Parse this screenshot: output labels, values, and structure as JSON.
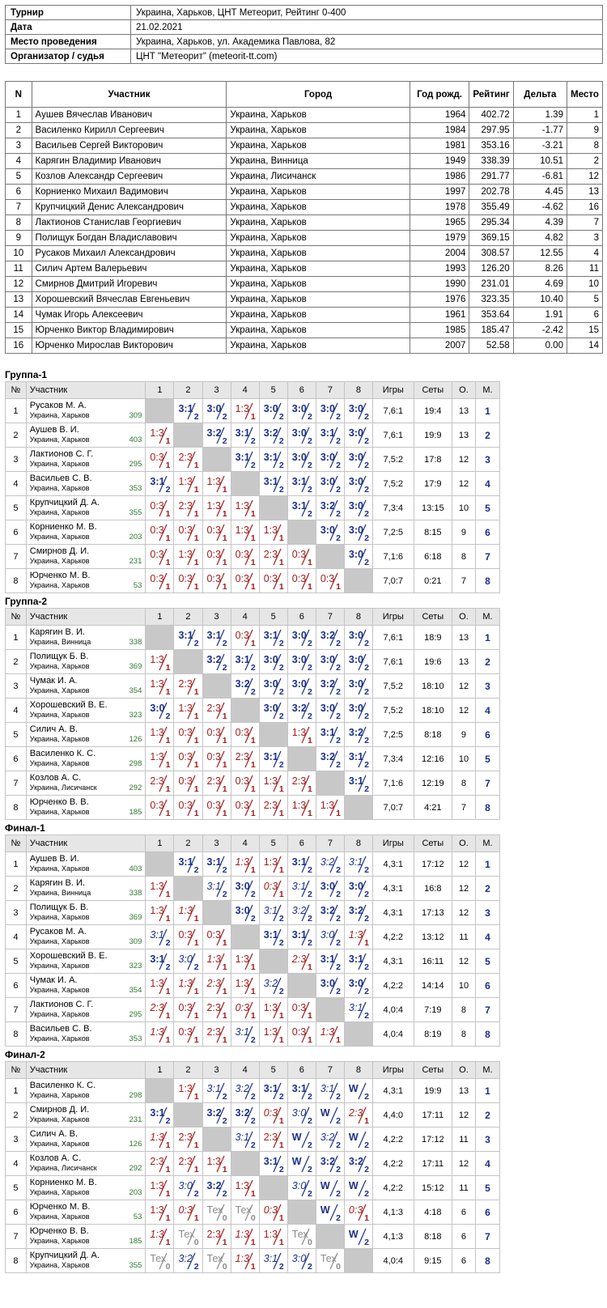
{
  "tournament": {
    "rows": [
      {
        "label": "Турнир",
        "value": "Украина, Харьков, ЦНТ Метеорит, Рейтинг 0-400"
      },
      {
        "label": "Дата",
        "value": "21.02.2021"
      },
      {
        "label": "Место проведения",
        "value": "Украина, Харьков, ул. Академика Павлова, 82"
      },
      {
        "label": "Организатор / судья",
        "value": "ЦНТ \"Метеорит\" (meteorit-tt.com)"
      }
    ]
  },
  "participants": {
    "headers": [
      "N",
      "Участник",
      "Город",
      "Год рожд.",
      "Рейтинг",
      "Дельта",
      "Место"
    ],
    "rows": [
      [
        "1",
        "Аушев Вячеслав Иванович",
        "Украина, Харьков",
        "1964",
        "402.72",
        "1.39",
        "1"
      ],
      [
        "2",
        "Василенко Кирилл Сергеевич",
        "Украина, Харьков",
        "1984",
        "297.95",
        "-1.77",
        "9"
      ],
      [
        "3",
        "Васильев Сергей Викторович",
        "Украина, Харьков",
        "1981",
        "353.16",
        "-3.21",
        "8"
      ],
      [
        "4",
        "Карягин Владимир Иванович",
        "Украина, Винница",
        "1949",
        "338.39",
        "10.51",
        "2"
      ],
      [
        "5",
        "Козлов Александр Сергеевич",
        "Украина, Лисичанск",
        "1986",
        "291.77",
        "-6.81",
        "12"
      ],
      [
        "6",
        "Корниенко Михаил Вадимович",
        "Украина, Харьков",
        "1997",
        "202.78",
        "4.45",
        "13"
      ],
      [
        "7",
        "Крупчицкий Денис Александрович",
        "Украина, Харьков",
        "1978",
        "355.49",
        "-4.62",
        "16"
      ],
      [
        "8",
        "Лактионов Станислав Георгиевич",
        "Украина, Харьков",
        "1965",
        "295.34",
        "4.39",
        "7"
      ],
      [
        "9",
        "Полищук Богдан Владиславович",
        "Украина, Харьков",
        "1979",
        "369.15",
        "4.82",
        "3"
      ],
      [
        "10",
        "Русаков Михаил Александрович",
        "Украина, Харьков",
        "2004",
        "308.57",
        "12.55",
        "4"
      ],
      [
        "11",
        "Силич Артем Валерьевич",
        "Украина, Харьков",
        "1993",
        "126.20",
        "8.26",
        "11"
      ],
      [
        "12",
        "Смирнов Дмитрий Игоревич",
        "Украина, Харьков",
        "1990",
        "231.01",
        "4.69",
        "10"
      ],
      [
        "13",
        "Хорошевский Вячеслав Евгеньевич",
        "Украина, Харьков",
        "1976",
        "323.35",
        "10.40",
        "5"
      ],
      [
        "14",
        "Чумак Игорь Алексеевич",
        "Украина, Харьков",
        "1961",
        "353.64",
        "1.91",
        "6"
      ],
      [
        "15",
        "Юрченко Виктор Владимирович",
        "Украина, Харьков",
        "1985",
        "185.47",
        "-2.42",
        "15"
      ],
      [
        "16",
        "Юрченко Мирослав Викторович",
        "Украина, Харьков",
        "2007",
        "52.58",
        "0.00",
        "14"
      ]
    ]
  },
  "grid_headers": [
    "№",
    "Участник",
    "1",
    "2",
    "3",
    "4",
    "5",
    "6",
    "7",
    "8",
    "Игры",
    "Сеты",
    "О.",
    "М."
  ],
  "groups": [
    {
      "title": "Группа-1",
      "rows": [
        {
          "n": "1",
          "name": "Русаков М. А.",
          "city": "Украина, Харьков",
          "rating": "309",
          "cells": [
            "X",
            "w3:1",
            "w3:0",
            "l1:3",
            "w3:0",
            "w3:0",
            "w3:0",
            "w3:0"
          ],
          "games": "7,6:1",
          "sets": "19:4",
          "pts": "13",
          "place": "1"
        },
        {
          "n": "2",
          "name": "Аушев В. И.",
          "city": "Украина, Харьков",
          "rating": "403",
          "cells": [
            "l1:3",
            "X",
            "w3:2",
            "w3:1",
            "w3:2",
            "w3:0",
            "w3:1",
            "w3:0"
          ],
          "games": "7,6:1",
          "sets": "19:9",
          "pts": "13",
          "place": "2"
        },
        {
          "n": "3",
          "name": "Лактионов С. Г.",
          "city": "Украина, Харьков",
          "rating": "295",
          "cells": [
            "l0:3",
            "l2:3",
            "X",
            "w3:1",
            "w3:1",
            "w3:0",
            "w3:0",
            "w3:0"
          ],
          "games": "7,5:2",
          "sets": "17:8",
          "pts": "12",
          "place": "3"
        },
        {
          "n": "4",
          "name": "Васильев С. В.",
          "city": "Украина, Харьков",
          "rating": "353",
          "cells": [
            "w3:1",
            "l1:3",
            "l1:3",
            "X",
            "w3:1",
            "w3:1",
            "w3:0",
            "w3:0"
          ],
          "games": "7,5:2",
          "sets": "17:9",
          "pts": "12",
          "place": "4"
        },
        {
          "n": "5",
          "name": "Крупчицкий Д. А.",
          "city": "Украина, Харьков",
          "rating": "355",
          "cells": [
            "l0:3",
            "l2:3",
            "l1:3",
            "l1:3",
            "X",
            "w3:1",
            "w3:2",
            "w3:0"
          ],
          "games": "7,3:4",
          "sets": "13:15",
          "pts": "10",
          "place": "5"
        },
        {
          "n": "6",
          "name": "Корниенко М. В.",
          "city": "Украина, Харьков",
          "rating": "203",
          "cells": [
            "l0:3",
            "l0:3",
            "l0:3",
            "l1:3",
            "l1:3",
            "X",
            "w3:0",
            "w3:0"
          ],
          "games": "7,2:5",
          "sets": "8:15",
          "pts": "9",
          "place": "6"
        },
        {
          "n": "7",
          "name": "Смирнов Д. И.",
          "city": "Украина, Харьков",
          "rating": "231",
          "cells": [
            "l0:3",
            "l1:3",
            "l0:3",
            "l0:3",
            "l2:3",
            "l0:3",
            "X",
            "w3:0"
          ],
          "games": "7,1:6",
          "sets": "6:18",
          "pts": "8",
          "place": "7"
        },
        {
          "n": "8",
          "name": "Юрченко М. В.",
          "city": "Украина, Харьков",
          "rating": "53",
          "cells": [
            "l0:3",
            "l0:3",
            "l0:3",
            "l0:3",
            "l0:3",
            "l0:3",
            "l0:3",
            "X"
          ],
          "games": "7,0:7",
          "sets": "0:21",
          "pts": "7",
          "place": "8"
        }
      ]
    },
    {
      "title": "Группа-2",
      "rows": [
        {
          "n": "1",
          "name": "Карягин В. И.",
          "city": "Украина, Винница",
          "rating": "338",
          "cells": [
            "X",
            "w3:1",
            "w3:1",
            "l0:3",
            "w3:1",
            "w3:0",
            "w3:2",
            "w3:0"
          ],
          "games": "7,6:1",
          "sets": "18:9",
          "pts": "13",
          "place": "1"
        },
        {
          "n": "2",
          "name": "Полищук Б. В.",
          "city": "Украина, Харьков",
          "rating": "369",
          "cells": [
            "l1:3",
            "X",
            "w3:2",
            "w3:1",
            "w3:0",
            "w3:0",
            "w3:0",
            "w3:0"
          ],
          "games": "7,6:1",
          "sets": "19:6",
          "pts": "13",
          "place": "2"
        },
        {
          "n": "3",
          "name": "Чумак И. А.",
          "city": "Украина, Харьков",
          "rating": "354",
          "cells": [
            "l1:3",
            "l2:3",
            "X",
            "w3:2",
            "w3:0",
            "w3:0",
            "w3:2",
            "w3:0"
          ],
          "games": "7,5:2",
          "sets": "18:10",
          "pts": "12",
          "place": "3"
        },
        {
          "n": "4",
          "name": "Хорошевский В. Е.",
          "city": "Украина, Харьков",
          "rating": "323",
          "cells": [
            "w3:0",
            "l1:3",
            "l2:3",
            "X",
            "w3:0",
            "w3:2",
            "w3:0",
            "w3:0"
          ],
          "games": "7,5:2",
          "sets": "18:10",
          "pts": "12",
          "place": "4"
        },
        {
          "n": "5",
          "name": "Силич А. В.",
          "city": "Украина, Харьков",
          "rating": "126",
          "cells": [
            "l1:3",
            "l0:3",
            "l0:3",
            "l0:3",
            "X",
            "l1:3",
            "w3:1",
            "w3:2"
          ],
          "games": "7,2:5",
          "sets": "8:18",
          "pts": "9",
          "place": "6"
        },
        {
          "n": "6",
          "name": "Василенко К. С.",
          "city": "Украина, Харьков",
          "rating": "298",
          "cells": [
            "l1:3",
            "l0:3",
            "l0:3",
            "l2:3",
            "w3:1",
            "X",
            "w3:2",
            "w3:1"
          ],
          "games": "7,3:4",
          "sets": "12:16",
          "pts": "10",
          "place": "5"
        },
        {
          "n": "7",
          "name": "Козлов А. С.",
          "city": "Украина, Лисичанск",
          "rating": "292",
          "cells": [
            "l2:3",
            "l0:3",
            "l2:3",
            "l0:3",
            "l1:3",
            "l2:3",
            "X",
            "w3:1"
          ],
          "games": "7,1:6",
          "sets": "12:19",
          "pts": "8",
          "place": "7"
        },
        {
          "n": "8",
          "name": "Юрченко В. В.",
          "city": "Украина, Харьков",
          "rating": "185",
          "cells": [
            "l0:3",
            "l0:3",
            "l0:3",
            "l0:3",
            "l2:3",
            "l1:3",
            "l1:3",
            "X"
          ],
          "games": "7,0:7",
          "sets": "4:21",
          "pts": "7",
          "place": "8"
        }
      ]
    },
    {
      "title": "Финал-1",
      "rows": [
        {
          "n": "1",
          "name": "Аушев В. И.",
          "city": "Украина, Харьков",
          "rating": "403",
          "cells": [
            "X",
            "w3:1",
            "w3:1",
            "li1:3",
            "l1:3",
            "w3:1",
            "wi3:2",
            "wi3:1"
          ],
          "games": "4,3:1",
          "sets": "17:12",
          "pts": "12",
          "place": "1"
        },
        {
          "n": "2",
          "name": "Карягин В. И.",
          "city": "Украина, Винница",
          "rating": "338",
          "cells": [
            "l1:3",
            "X",
            "wi3:1",
            "w3:0",
            "li0:3",
            "wi3:1",
            "w3:0",
            "w3:0"
          ],
          "games": "4,3:1",
          "sets": "16:8",
          "pts": "12",
          "place": "2"
        },
        {
          "n": "3",
          "name": "Полищук Б. В.",
          "city": "Украина, Харьков",
          "rating": "369",
          "cells": [
            "l1:3",
            "li1:3",
            "X",
            "w3:0",
            "wi3:1",
            "wi3:2",
            "w3:2",
            "w3:2"
          ],
          "games": "4,3:1",
          "sets": "17:13",
          "pts": "12",
          "place": "3"
        },
        {
          "n": "4",
          "name": "Русаков М. А.",
          "city": "Украина, Харьков",
          "rating": "309",
          "cells": [
            "wi3:1",
            "l0:3",
            "l0:3",
            "X",
            "w3:1",
            "w3:1",
            "wi3:0",
            "li1:3"
          ],
          "games": "4,2:2",
          "sets": "13:12",
          "pts": "11",
          "place": "4"
        },
        {
          "n": "5",
          "name": "Хорошевский В. Е.",
          "city": "Украина, Харьков",
          "rating": "323",
          "cells": [
            "w3:1",
            "wi3:0",
            "li1:3",
            "l1:3",
            "X",
            "li2:3",
            "w3:1",
            "w3:1"
          ],
          "games": "4,3:1",
          "sets": "16:11",
          "pts": "12",
          "place": "5"
        },
        {
          "n": "6",
          "name": "Чумак И. А.",
          "city": "Украина, Харьков",
          "rating": "354",
          "cells": [
            "l1:3",
            "li1:3",
            "li2:3",
            "l1:3",
            "wi3:2",
            "X",
            "w3:0",
            "w3:0"
          ],
          "games": "4,2:2",
          "sets": "14:14",
          "pts": "10",
          "place": "6"
        },
        {
          "n": "7",
          "name": "Лактионов С. Г.",
          "city": "Украина, Харьков",
          "rating": "295",
          "cells": [
            "li2:3",
            "l0:3",
            "l2:3",
            "li0:3",
            "l1:3",
            "l0:3",
            "X",
            "wi3:1"
          ],
          "games": "4,0:4",
          "sets": "7:19",
          "pts": "8",
          "place": "7"
        },
        {
          "n": "8",
          "name": "Васильев С. В.",
          "city": "Украина, Харьков",
          "rating": "353",
          "cells": [
            "li1:3",
            "l0:3",
            "l2:3",
            "wi3:1",
            "l1:3",
            "l0:3",
            "li1:3",
            "X"
          ],
          "games": "4,0:4",
          "sets": "8:19",
          "pts": "8",
          "place": "8"
        }
      ]
    },
    {
      "title": "Финал-2",
      "rows": [
        {
          "n": "1",
          "name": "Василенко К. С.",
          "city": "Украина, Харьков",
          "rating": "298",
          "cells": [
            "X",
            "l1:3",
            "wi3:1",
            "wi3:2",
            "w3:1",
            "w3:1",
            "wi3:1",
            "wW"
          ],
          "games": "4,3:1",
          "sets": "19:9",
          "pts": "13",
          "place": "1"
        },
        {
          "n": "2",
          "name": "Смирнов Д. И.",
          "city": "Украина, Харьков",
          "rating": "231",
          "cells": [
            "w3:1",
            "X",
            "w3:2",
            "w3:2",
            "li0:3",
            "wi3:0",
            "wW",
            "li2:3"
          ],
          "games": "4,4:0",
          "sets": "17:11",
          "pts": "12",
          "place": "2"
        },
        {
          "n": "3",
          "name": "Силич А. В.",
          "city": "Украина, Харьков",
          "rating": "126",
          "cells": [
            "li1:3",
            "l2:3",
            "X",
            "wi3:1",
            "l2:3",
            "wW",
            "wi3:2",
            "wW"
          ],
          "games": "4,2:2",
          "sets": "17:12",
          "pts": "11",
          "place": "3"
        },
        {
          "n": "4",
          "name": "Козлов А. С.",
          "city": "Украина, Лисичанск",
          "rating": "292",
          "cells": [
            "l2:3",
            "l2:3",
            "l1:3",
            "X",
            "w3:1",
            "wW",
            "w3:2",
            "w3:2"
          ],
          "games": "4,2:2",
          "sets": "17:11",
          "pts": "12",
          "place": "4"
        },
        {
          "n": "5",
          "name": "Корниенко М. В.",
          "city": "Украина, Харьков",
          "rating": "203",
          "cells": [
            "l1:3",
            "wi3:0",
            "w3:2",
            "l1:3",
            "X",
            "wi3:0",
            "wW",
            "wW"
          ],
          "games": "4,2:2",
          "sets": "15:12",
          "pts": "11",
          "place": "5"
        },
        {
          "n": "6",
          "name": "Юрченко М. В.",
          "city": "Украина, Харьков",
          "rating": "53",
          "cells": [
            "l1:3",
            "li0:3",
            "tТех",
            "tТех",
            "li0:3",
            "X",
            "wW",
            "li0:3"
          ],
          "games": "4,1:3",
          "sets": "4:18",
          "pts": "6",
          "place": "6"
        },
        {
          "n": "7",
          "name": "Юрченко В. В.",
          "city": "Украина, Харьков",
          "rating": "185",
          "cells": [
            "li1:3",
            "tТех",
            "l2:3",
            "li1:3",
            "l1:3",
            "tТех",
            "X",
            "wW"
          ],
          "games": "4,1:3",
          "sets": "8:18",
          "pts": "6",
          "place": "7"
        },
        {
          "n": "8",
          "name": "Крупчицкий Д. А.",
          "city": "Украина, Харьков",
          "rating": "355",
          "cells": [
            "tТех",
            "wi3:2",
            "tТех",
            "li1:3",
            "wi3:1",
            "wi3:0",
            "tТех",
            "X"
          ],
          "games": "4,0:4",
          "sets": "9:15",
          "pts": "6",
          "place": "8"
        }
      ]
    }
  ]
}
